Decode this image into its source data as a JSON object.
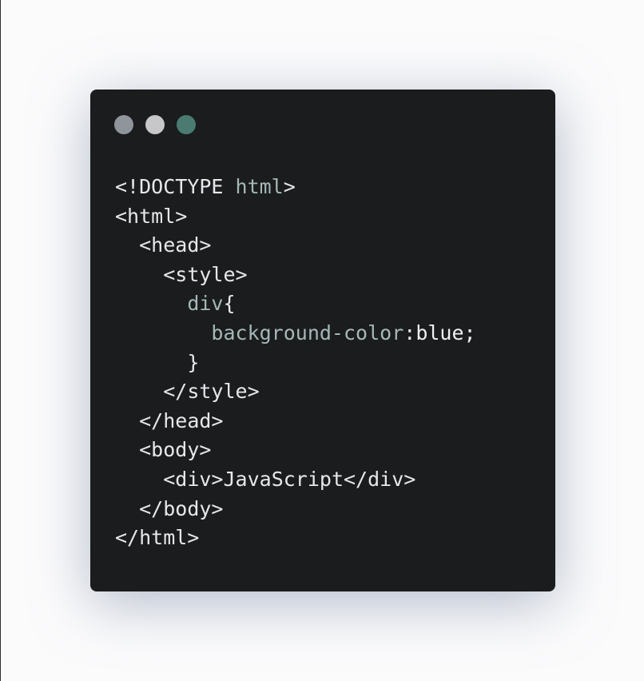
{
  "window": {
    "controls": [
      {
        "name": "close-dot",
        "color": "#8f959b"
      },
      {
        "name": "minimize-dot",
        "color": "#c7c7c9"
      },
      {
        "name": "maximize-dot",
        "color": "#4a7a70"
      }
    ]
  },
  "code": {
    "lines": [
      {
        "indent": "",
        "tokens": [
          {
            "cls": "tk-tag",
            "text": "<!DOCTYPE "
          },
          {
            "cls": "tk-attr",
            "text": "html"
          },
          {
            "cls": "tk-tag",
            "text": ">"
          }
        ]
      },
      {
        "indent": "",
        "tokens": [
          {
            "cls": "tk-tag",
            "text": "<html>"
          }
        ]
      },
      {
        "indent": "  ",
        "tokens": [
          {
            "cls": "tk-tag",
            "text": "<head>"
          }
        ]
      },
      {
        "indent": "    ",
        "tokens": [
          {
            "cls": "tk-tag",
            "text": "<style>"
          }
        ]
      },
      {
        "indent": "      ",
        "tokens": [
          {
            "cls": "tk-sel",
            "text": "div"
          },
          {
            "cls": "tk-tag",
            "text": "{"
          }
        ]
      },
      {
        "indent": "        ",
        "tokens": [
          {
            "cls": "tk-prop",
            "text": "background-color"
          },
          {
            "cls": "tk-tag",
            "text": ":"
          },
          {
            "cls": "tk-val",
            "text": "blue;"
          }
        ]
      },
      {
        "indent": "      ",
        "tokens": [
          {
            "cls": "tk-tag",
            "text": "}"
          }
        ]
      },
      {
        "indent": "    ",
        "tokens": [
          {
            "cls": "tk-tag",
            "text": "</style>"
          }
        ]
      },
      {
        "indent": "  ",
        "tokens": [
          {
            "cls": "tk-tag",
            "text": "</head>"
          }
        ]
      },
      {
        "indent": "  ",
        "tokens": [
          {
            "cls": "tk-tag",
            "text": "<body>"
          }
        ]
      },
      {
        "indent": "    ",
        "tokens": [
          {
            "cls": "tk-tag",
            "text": "<div>"
          },
          {
            "cls": "tk-text",
            "text": "JavaScript"
          },
          {
            "cls": "tk-tag",
            "text": "</div>"
          }
        ]
      },
      {
        "indent": "  ",
        "tokens": [
          {
            "cls": "tk-tag",
            "text": "</body>"
          }
        ]
      },
      {
        "indent": "",
        "tokens": [
          {
            "cls": "tk-tag",
            "text": "</html>"
          }
        ]
      }
    ]
  }
}
